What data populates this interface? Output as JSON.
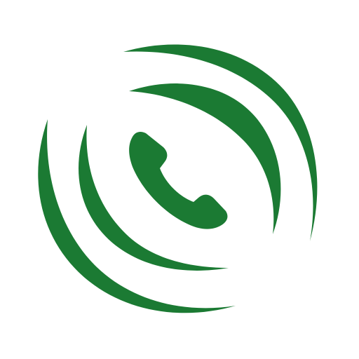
{
  "icon": {
    "name": "phone-call-icon",
    "color": "#1b7a33",
    "background": "#ffffff",
    "parts": [
      "phone-handset-icon",
      "signal-wave-inner-top",
      "signal-wave-outer-top",
      "signal-wave-inner-bottom",
      "signal-wave-outer-bottom"
    ]
  }
}
